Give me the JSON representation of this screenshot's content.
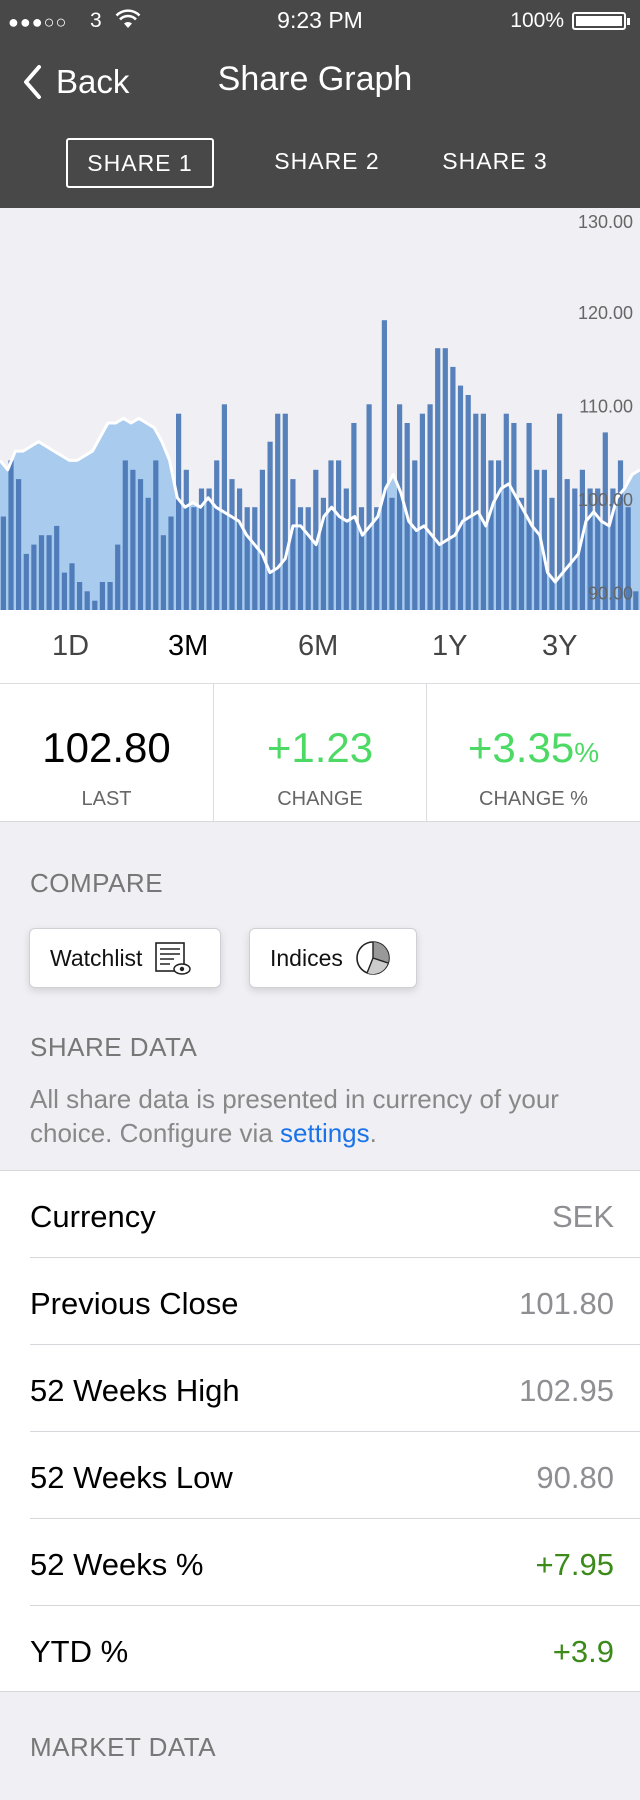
{
  "status_bar": {
    "signal": "●●●○○",
    "carrier": "3",
    "time": "9:23 PM",
    "battery": "100%"
  },
  "nav": {
    "back_label": "Back",
    "title": "Share Graph",
    "tabs": [
      {
        "label": "SHARE 1",
        "active": true
      },
      {
        "label": "SHARE 2",
        "active": false
      },
      {
        "label": "SHARE 3",
        "active": false
      }
    ]
  },
  "chart_data": {
    "type": "bar",
    "description_series": [
      "volume",
      "price"
    ],
    "y_ticks": [
      "130.00",
      "120.00",
      "110.00",
      "100.00",
      "90.00"
    ],
    "ylim": [
      88,
      131
    ],
    "grid": false,
    "colors": {
      "bars": "#4674b4",
      "price_fill": "#a9cbee",
      "price_line": "#ffffff"
    },
    "series": [
      {
        "name": "",
        "type": "bar",
        "values": [
          98,
          104,
          102,
          94,
          95,
          96,
          96,
          97,
          92,
          93,
          91,
          90,
          89,
          91,
          91,
          95,
          104,
          103,
          102,
          100,
          104,
          96,
          98,
          109,
          103,
          99,
          101,
          101,
          104,
          110,
          102,
          101,
          99,
          99,
          103,
          106,
          109,
          109,
          102,
          99,
          99,
          103,
          100,
          104,
          104,
          101,
          108,
          99,
          110,
          99,
          119,
          100,
          110,
          108,
          104,
          109,
          110,
          116,
          116,
          114,
          112,
          111,
          109,
          109,
          104,
          104,
          109,
          108,
          100,
          108,
          103,
          103,
          100,
          109,
          102,
          101,
          103,
          101,
          101,
          107,
          101,
          104,
          99,
          90
        ]
      },
      {
        "name": "",
        "type": "area",
        "values": [
          104,
          103,
          105,
          105,
          105.5,
          106,
          105.5,
          105,
          104.5,
          104,
          104,
          104.5,
          105,
          106.5,
          108,
          108,
          108.5,
          108,
          108.5,
          108,
          107.5,
          106,
          104,
          100,
          99,
          99.5,
          99,
          100,
          99,
          98.5,
          98,
          97.5,
          96,
          95,
          94,
          92,
          92.5,
          93.5,
          97,
          97,
          96,
          95,
          98,
          99,
          98,
          97.5,
          98,
          96,
          97,
          98,
          101,
          102.5,
          100.5,
          97.5,
          96.5,
          97,
          96,
          95,
          95.5,
          96,
          97.5,
          98,
          98.5,
          97,
          99.5,
          101,
          101.5,
          100,
          98.5,
          97,
          96,
          92,
          91,
          92,
          93,
          94,
          97.5,
          98.5,
          97.5,
          97,
          100,
          101,
          102.5,
          103
        ]
      }
    ]
  },
  "ranges": {
    "items": [
      {
        "label": "1D",
        "active": false
      },
      {
        "label": "3M",
        "active": true
      },
      {
        "label": "6M",
        "active": false
      },
      {
        "label": "1Y",
        "active": false
      },
      {
        "label": "3Y",
        "active": false
      }
    ]
  },
  "stats": {
    "last": {
      "value": "102.80",
      "caption": "LAST"
    },
    "change": {
      "value": "+1.23",
      "caption": "CHANGE"
    },
    "change_pct": {
      "value": "+3.35",
      "unit": "%",
      "caption": "CHANGE %"
    }
  },
  "compare": {
    "label": "COMPARE",
    "watchlist_label": "Watchlist",
    "indices_label": "Indices"
  },
  "share_data": {
    "label": "SHARE DATA",
    "note_text": "All share data is presented in currency of your choice. Configure via ",
    "note_link": "settings",
    "note_end": ".",
    "rows": [
      {
        "label": "Currency",
        "value": "SEK",
        "color": "#8e8e93"
      },
      {
        "label": "Previous Close",
        "value": "101.80",
        "color": "#8e8e93"
      },
      {
        "label": "52 Weeks High",
        "value": "102.95",
        "color": "#8e8e93"
      },
      {
        "label": "52 Weeks Low",
        "value": "90.80",
        "color": "#8e8e93"
      },
      {
        "label": "52 Weeks %",
        "value": "+7.95",
        "color": "#3b8a1a"
      },
      {
        "label": "YTD %",
        "value": "+3.9",
        "color": "#3b8a1a"
      }
    ]
  },
  "market_data": {
    "label": "MARKET DATA"
  }
}
